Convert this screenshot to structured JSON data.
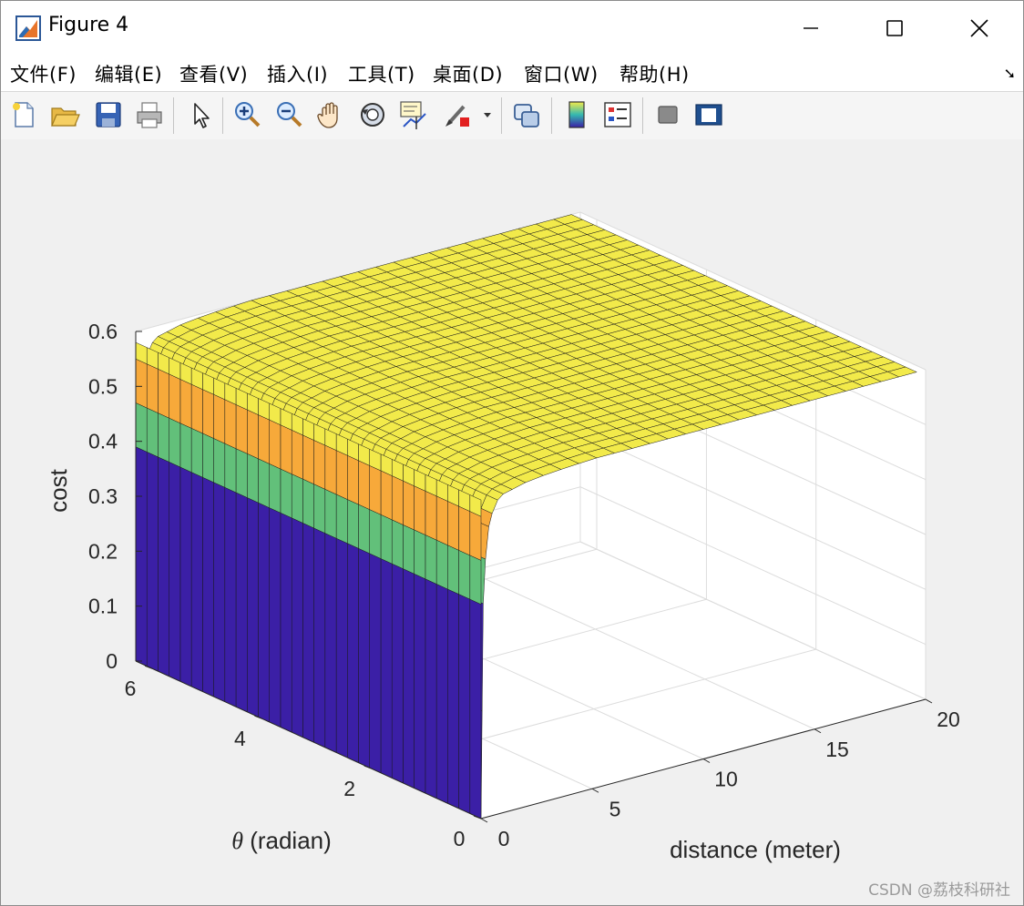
{
  "window": {
    "title": "Figure 4"
  },
  "menu": {
    "items": [
      "文件(F)",
      "编辑(E)",
      "查看(V)",
      "插入(I)",
      "工具(T)",
      "桌面(D)",
      "窗口(W)",
      "帮助(H)"
    ],
    "overflow_icon": "dock-arrow-icon"
  },
  "toolbar": {
    "tools": [
      "new-figure-icon",
      "open-file-icon",
      "save-icon",
      "print-icon",
      "edit-plot-icon",
      "zoom-in-icon",
      "zoom-out-icon",
      "pan-icon",
      "rotate-3d-icon",
      "data-cursor-icon",
      "brush-icon",
      "link-plot-icon",
      "colorbar-icon",
      "legend-icon",
      "hide-plot-tools-icon",
      "show-plot-tools-icon"
    ]
  },
  "chart_data": {
    "type": "surface",
    "title": "",
    "xlabel": "distance (meter)",
    "ylabel": "θ (radian)",
    "zlabel": "cost",
    "xlim": [
      0,
      20
    ],
    "ylim": [
      0,
      6.3
    ],
    "zlim": [
      0,
      0.6
    ],
    "xticks": [
      "0",
      "5",
      "10",
      "15",
      "20"
    ],
    "yticks": [
      "0",
      "2",
      "4",
      "6"
    ],
    "zticks": [
      "0",
      "0.1",
      "0.2",
      "0.3",
      "0.4",
      "0.5",
      "0.6"
    ],
    "y_symbol": "θ",
    "y_unit_label": "(radian)",
    "grid": true,
    "colormap": "parula",
    "colors": {
      "low": "#3b1fa6",
      "band": "#62c07a",
      "orange": "#f7a93a",
      "high": "#f2ea4a"
    },
    "surface_profile": {
      "x": [
        0,
        0.1,
        0.2,
        0.3,
        0.5,
        0.7,
        1.0,
        1.5,
        2.0,
        3.0,
        5.0,
        8.0,
        12.0,
        16.0,
        20.0
      ],
      "cost": [
        0,
        0.39,
        0.47,
        0.52,
        0.55,
        0.57,
        0.58,
        0.585,
        0.59,
        0.595,
        0.6,
        0.6,
        0.6,
        0.6,
        0.6
      ],
      "constant_in_theta": true
    }
  },
  "watermark": "CSDN @荔枝科研社"
}
